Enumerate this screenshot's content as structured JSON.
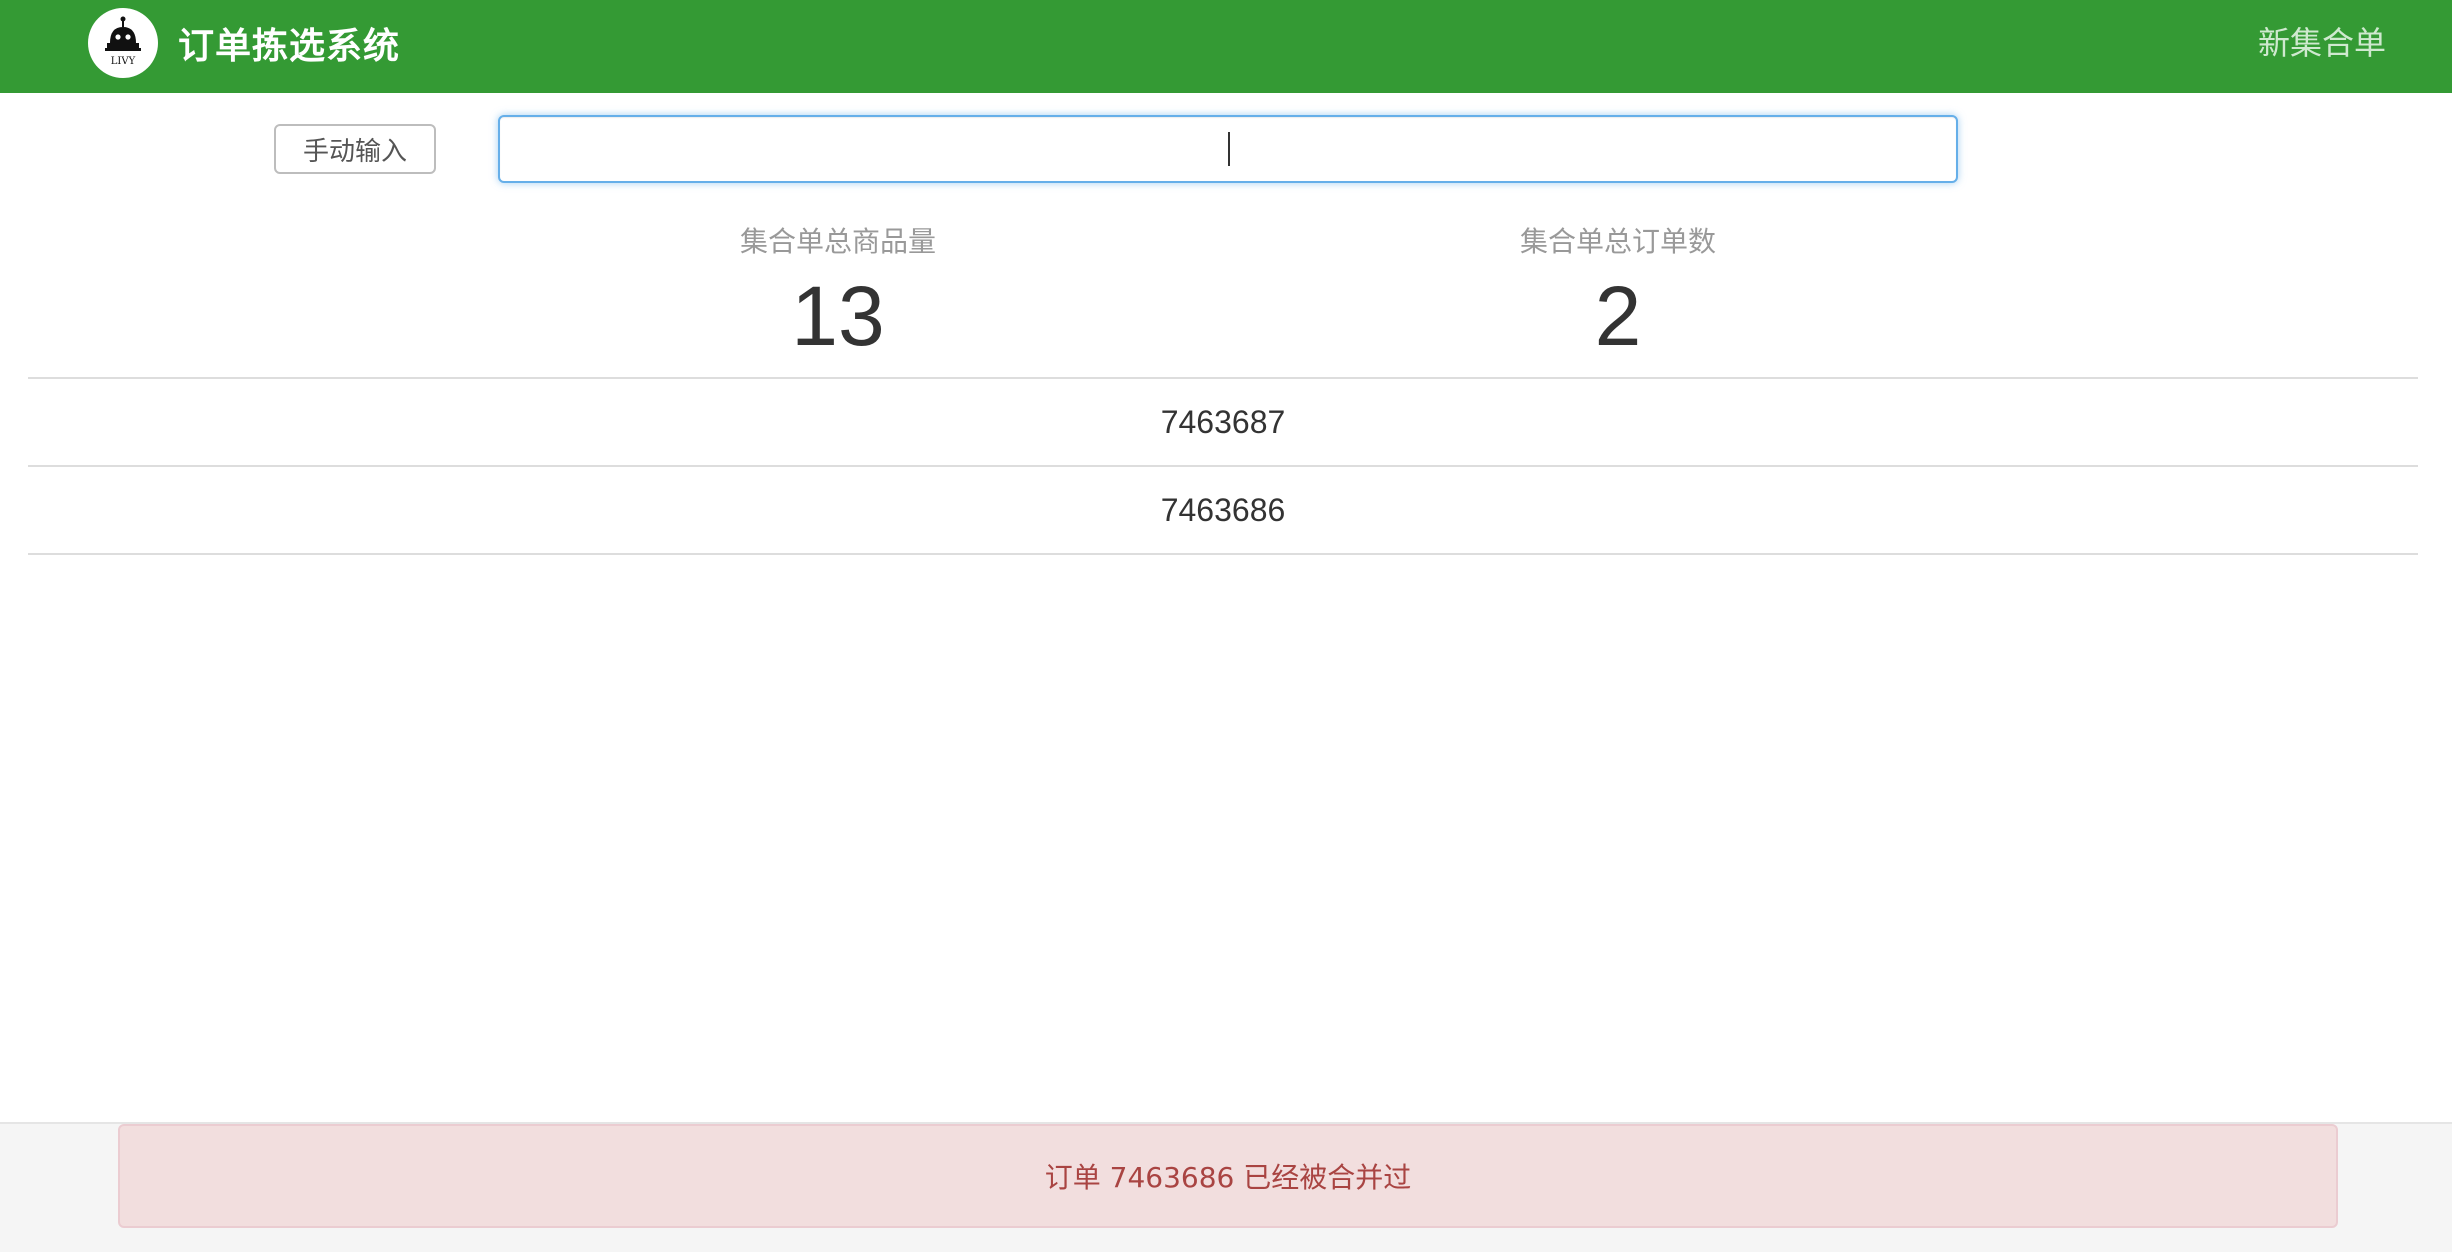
{
  "navbar": {
    "logo_text": "LIVY",
    "title": "订单拣选系统",
    "right_link": "新集合单",
    "bg_color": "#349a34"
  },
  "input_row": {
    "manual_button": "手动输入",
    "scan_input_value": "",
    "scan_input_placeholder": ""
  },
  "stats": {
    "total_items_label": "集合单总商品量",
    "total_items_value": "13",
    "total_orders_label": "集合单总订单数",
    "total_orders_value": "2"
  },
  "orders": [
    "7463687",
    "7463686"
  ],
  "alert": {
    "message": "订单 7463686 已经被合并过",
    "bg_color": "#f2dede",
    "text_color": "#a94442"
  }
}
